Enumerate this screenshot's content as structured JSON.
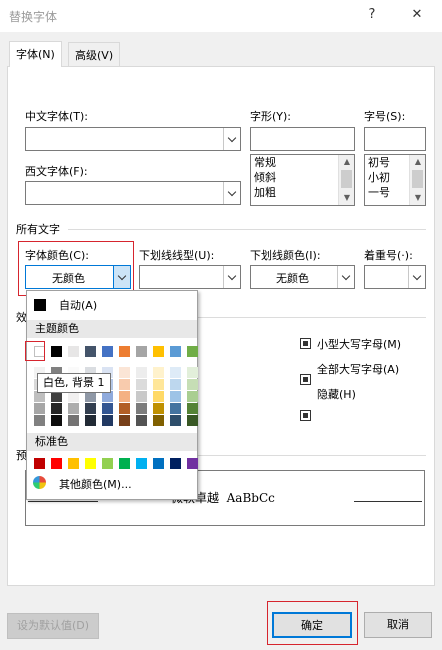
{
  "window": {
    "title": "替换字体",
    "help_icon": "?",
    "close_icon": "✕"
  },
  "tabs": [
    {
      "label": "字体(N)"
    },
    {
      "label": "高级(V)"
    }
  ],
  "font": {
    "cn_font_label": "中文字体(T):",
    "cn_font_value": "",
    "west_font_label": "西文字体(F):",
    "west_font_value": "",
    "style_label": "字形(Y):",
    "style_value": "",
    "style_options": [
      "常规",
      "倾斜",
      "加粗"
    ],
    "size_label": "字号(S):",
    "size_value": "",
    "size_options": [
      "初号",
      "小初",
      "一号"
    ]
  },
  "all_text": {
    "section_label": "所有文字",
    "font_color_label": "字体颜色(C):",
    "font_color_value": "无颜色",
    "underline_style_label": "下划线线型(U):",
    "underline_style_value": "",
    "underline_color_label": "下划线颜色(I):",
    "underline_color_value": "无颜色",
    "emphasis_label": "着重号(·):",
    "emphasis_value": ""
  },
  "effects": {
    "section_label_partial": "效",
    "small_caps": "小型大写字母(M)",
    "all_caps": "全部大写字母(A)",
    "hidden": "隐藏(H)"
  },
  "preview": {
    "section_label_partial": "预",
    "sample_text": "微软卓越  AaBbCc"
  },
  "palette": {
    "auto_label": "自动(A)",
    "theme_label": "主题颜色",
    "standard_label": "标准色",
    "more_colors_label": "其他颜色(M)...",
    "tooltip": "白色, 背景 1",
    "theme_row": [
      "#ffffff",
      "#000000",
      "#e7e6e6",
      "#44546a",
      "#4472c4",
      "#ed7d31",
      "#a5a5a5",
      "#ffc000",
      "#5b9bd5",
      "#70ad47"
    ],
    "standard_row": [
      "#c00000",
      "#ff0000",
      "#ffc000",
      "#ffff00",
      "#92d050",
      "#00b050",
      "#00b0f0",
      "#0070c0",
      "#002060",
      "#7030a0"
    ]
  },
  "buttons": {
    "set_default": "设为默认值(D)",
    "ok": "确定",
    "cancel": "取消"
  },
  "colors": {
    "highlight_red": "#d6252e",
    "combo_focus_blue": "#cce4f7"
  }
}
